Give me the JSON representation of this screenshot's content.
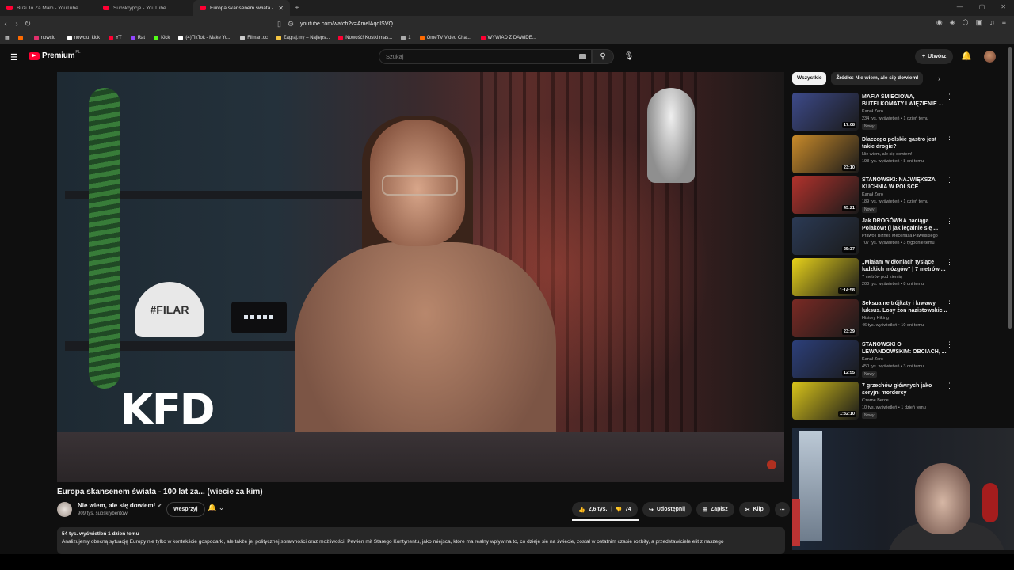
{
  "browser": {
    "tabs": [
      {
        "label": "Buzi To Za Mało - YouTube",
        "active": false
      },
      {
        "label": "Subskrypcje - YouTube",
        "active": false
      },
      {
        "label": "Europa skansenem świata - ",
        "active": true
      }
    ],
    "url": "youtube.com/watch?v=AmelAqdISVQ",
    "bookmarks": [
      {
        "label": "nowciu_",
        "color": "#e1306c"
      },
      {
        "label": "nowciu_kick",
        "color": "#ffffff"
      },
      {
        "label": "YT",
        "color": "#ff0033"
      },
      {
        "label": "Rat",
        "color": "#9146ff"
      },
      {
        "label": "Kick",
        "color": "#53fc18"
      },
      {
        "label": "(4)TikTok - Make Yo...",
        "color": "#ffffff"
      },
      {
        "label": "Filman.cc",
        "color": "#cccccc"
      },
      {
        "label": "Zagraj.my – Najleps...",
        "color": "#f5c542"
      },
      {
        "label": "Nowość! Kostki mas...",
        "color": "#ff0033"
      },
      {
        "label": "1",
        "color": "#aaaaaa"
      },
      {
        "label": "OmeTV Video Chat...",
        "color": "#ff6a00"
      },
      {
        "label": "WYWIAD Z DAWIDE...",
        "color": "#ff0033"
      }
    ]
  },
  "header": {
    "logo_text": "Premium",
    "logo_country": "PL",
    "search_placeholder": "Szukaj",
    "create_label": "Utwórz"
  },
  "video": {
    "overlay_text": "KFD",
    "title": "Europa skansenem świata - 100 lat za... (wiecie za kim)",
    "channel_name": "Nie wiem, ale się dowiem!",
    "subscribers": "909 tys. subskrybentów",
    "support_label": "Wesprzyj",
    "likes": "2,6 tys.",
    "dislikes": "74",
    "share_label": "Udostępnij",
    "save_label": "Zapisz",
    "clip_label": "Klip",
    "views_date": "54 tys. wyświetleń  1 dzień temu",
    "description": "Analizujemy obecną sytuację Europy nie tylko w kontekście gospodarki, ale także jej politycznej sprawności oraz możliwości. Pewien mit Starego Kontynentu, jako miejsca, które ma realny wpływ na to, co dzieje się na świecie, został w ostatnim czasie rozbity, a przedstawiciele elit z naszego"
  },
  "sidebar": {
    "chips": [
      "Wszystkie",
      "Źródło: Nie wiem, ale się dowiem!"
    ],
    "items": [
      {
        "title": "MAFIA ŚMIECIOWA, BUTELKOMATY I WIĘZIENIE ...",
        "channel": "Kanał Zero",
        "views": "234 tys. wyświetleń • 1 dzień temu",
        "badge": "Nowy",
        "duration": "17:08",
        "thumb": "#3d4a8a"
      },
      {
        "title": "Dlaczego polskie gastro jest takie drogie?",
        "channel": "Nie wiem, ale się dowiem!",
        "views": "198 tys. wyświetleń • 8 dni temu",
        "badge": "",
        "duration": "23:10",
        "thumb": "#c88a2a"
      },
      {
        "title": "STANOWSKI: NAJWIĘKSZA KUCHNIA W POLSCE",
        "channel": "Kanał Zero",
        "views": "189 tys. wyświetleń • 1 dzień temu",
        "badge": "Nowy",
        "duration": "45:21",
        "thumb": "#b2322c"
      },
      {
        "title": "Jak DROGÓWKA naciąga Polaków! (i jak legalnie się ...",
        "channel": "Prawo i Biznes Mecenasa Pawelskiego",
        "views": "707 tys. wyświetleń • 3 tygodnie temu",
        "badge": "",
        "duration": "25:37",
        "thumb": "#2b3a55"
      },
      {
        "title": "„Miałam w dłoniach tysiące ludzkich mózgów\" | 7 metrów ...",
        "channel": "7 metrów pod ziemią",
        "views": "200 tys. wyświetleń • 8 dni temu",
        "badge": "",
        "duration": "1:14:58",
        "thumb": "#e8d21a"
      },
      {
        "title": "Seksualne trójkąty i krwawy luksus. Losy żon nazistowskic...",
        "channel": "History Hiking",
        "views": "46 tys. wyświetleń • 10 dni temu",
        "badge": "",
        "duration": "23:39",
        "thumb": "#7a2a24"
      },
      {
        "title": "STANOWSKI O LEWANDOWSKIM: OBCIACH, ...",
        "channel": "Kanał Zero",
        "views": "450 tys. wyświetleń • 3 dni temu",
        "badge": "Nowy",
        "duration": "12:55",
        "thumb": "#2c3f7a"
      },
      {
        "title": "7 grzechów głównych jako seryjni mordercy",
        "channel": "Czarne Berce",
        "views": "10 tys. wyświetleń • 1 dzień temu",
        "badge": "Nowy",
        "duration": "1:32:10",
        "thumb": "#d9c41a"
      }
    ]
  },
  "colors": {
    "accent": "#ff0033",
    "background": "#0f0f0f",
    "surface": "#272727"
  }
}
